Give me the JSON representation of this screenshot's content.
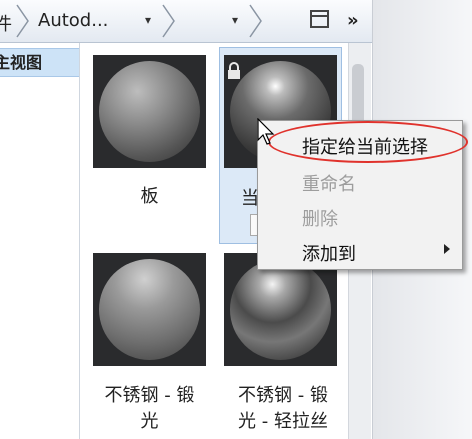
{
  "toolbar": {
    "crumb_prefix": "件",
    "crumb_main": "Autod...",
    "dropdown_glyph": "▾",
    "more_glyph": "»"
  },
  "left_panel": {
    "selected_item": "主视图"
  },
  "materials": [
    {
      "label": "板",
      "color": "#7a7a7a"
    },
    {
      "label": "当",
      "color": "#4a4a4a"
    },
    {
      "label": "不锈钢 - 锻\n光",
      "color": "#8a8a8a"
    },
    {
      "label": "不锈钢 - 锻\n光 - 轻拉丝",
      "color": "#555555"
    }
  ],
  "context_menu": {
    "items": [
      {
        "label": "指定给当前选择",
        "enabled": true
      },
      {
        "label": "重命名",
        "enabled": false
      },
      {
        "label": "删除",
        "enabled": false
      },
      {
        "label": "添加到",
        "enabled": true,
        "submenu": true
      }
    ]
  },
  "colors": {
    "selection": "#cde3f7",
    "highlight_ellipse": "#e0322c",
    "menu_bg": "#f2f2f2"
  }
}
